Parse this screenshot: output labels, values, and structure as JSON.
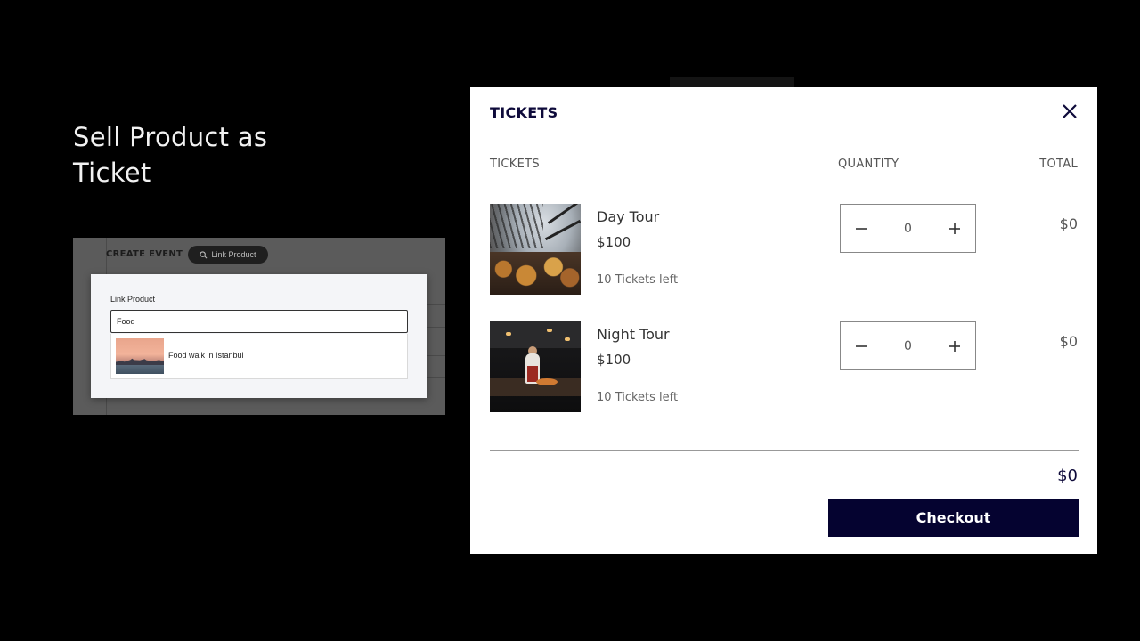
{
  "headline": "Sell Product as Ticket",
  "preview": {
    "create_event": "CREATE EVENT",
    "link_product_button": "Link Product",
    "dialog_label": "Link Product",
    "search_value": "Food",
    "result_label": "Food walk in Istanbul"
  },
  "modal": {
    "title": "TICKETS",
    "columns": {
      "tickets": "TICKETS",
      "quantity": "QUANTITY",
      "total": "TOTAL"
    },
    "rows": [
      {
        "name": "Day Tour",
        "price": "$100",
        "tickets_left": "10 Tickets left",
        "quantity": "0",
        "total": "$0",
        "image": "bbq-grill-photo"
      },
      {
        "name": "Night Tour",
        "price": "$100",
        "tickets_left": "10 Tickets left",
        "quantity": "0",
        "total": "$0",
        "image": "night-market-cook-photo"
      }
    ],
    "grand_total": "$0",
    "checkout_label": "Checkout"
  },
  "colors": {
    "accent": "#050330",
    "title": "#0e0a3a",
    "background": "#000000"
  },
  "icons": {
    "close": "close-icon",
    "minus": "minus-icon",
    "plus": "plus-icon",
    "search": "search-icon"
  }
}
